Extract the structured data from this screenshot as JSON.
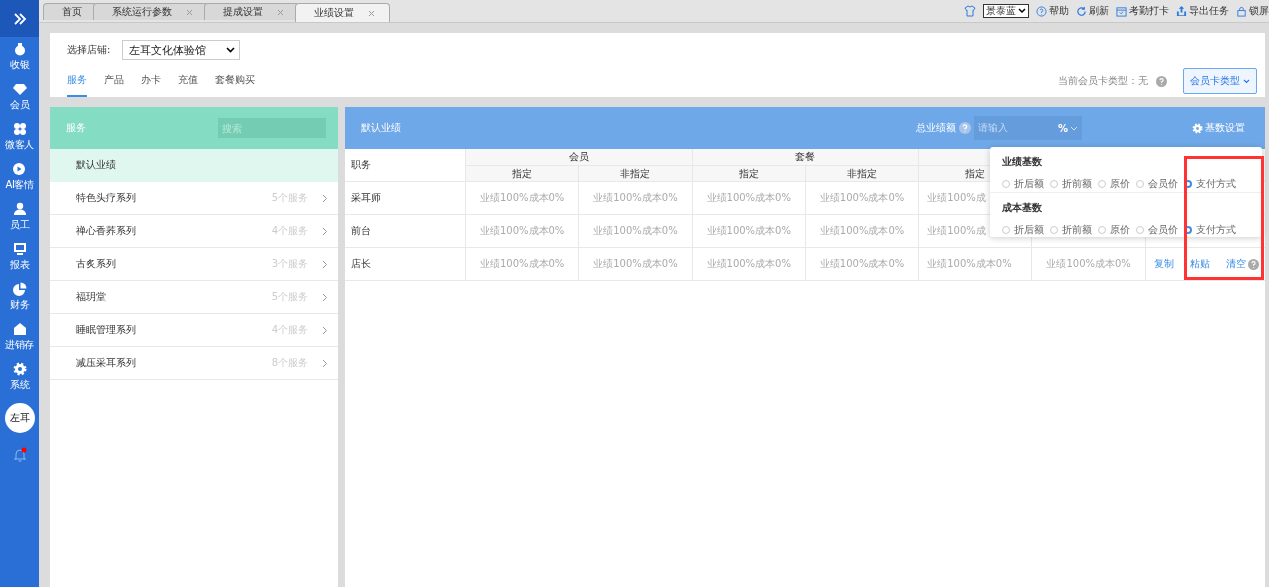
{
  "sidebar": {
    "items": [
      {
        "label": "收银",
        "kind": "cash"
      },
      {
        "label": "会员",
        "kind": "diamond"
      },
      {
        "label": "微客人",
        "kind": "clover"
      },
      {
        "label": "AI客情",
        "kind": "play"
      },
      {
        "label": "员工",
        "kind": "person"
      },
      {
        "label": "报表",
        "kind": "monitor"
      },
      {
        "label": "财务",
        "kind": "pie"
      },
      {
        "label": "进销存",
        "kind": "house"
      },
      {
        "label": "系统",
        "kind": "gear"
      }
    ],
    "avatar": "左耳"
  },
  "tabs": [
    {
      "label": "首页",
      "closable": false,
      "selected": false
    },
    {
      "label": "系统运行参数",
      "closable": true,
      "selected": false
    },
    {
      "label": "提成设置",
      "closable": true,
      "selected": false
    },
    {
      "label": "业绩设置",
      "closable": true,
      "selected": true
    }
  ],
  "toolbar": {
    "theme": "景泰蓝",
    "actions": [
      {
        "label": "帮助",
        "kind": "help"
      },
      {
        "label": "刷新",
        "kind": "refresh"
      },
      {
        "label": "考勤打卡",
        "kind": "calendar"
      },
      {
        "label": "导出任务",
        "kind": "export"
      },
      {
        "label": "锁屏",
        "kind": "lock"
      }
    ]
  },
  "store": {
    "label": "选择店铺:",
    "value": "左耳文化体验馆"
  },
  "category_tabs": [
    {
      "label": "服务",
      "selected": true
    },
    {
      "label": "产品",
      "selected": false
    },
    {
      "label": "办卡",
      "selected": false
    },
    {
      "label": "充值",
      "selected": false
    },
    {
      "label": "套餐购买",
      "selected": false
    }
  ],
  "card_type": {
    "current": "当前会员卡类型：无",
    "button": "会员卡类型"
  },
  "service_panel": {
    "title": "服务",
    "search_placeholder": "搜索",
    "items": [
      {
        "name": "默认业绩",
        "selected": true
      },
      {
        "name": "特色头疗系列",
        "count": "5个服务",
        "selected": false
      },
      {
        "name": "禅心香荞系列",
        "count": "4个服务",
        "selected": false
      },
      {
        "name": "古炙系列",
        "count": "3个服务",
        "selected": false
      },
      {
        "name": "福玥堂",
        "count": "5个服务",
        "selected": false
      },
      {
        "name": "睡眠管理系列",
        "count": "4个服务",
        "selected": false
      },
      {
        "name": "减压采耳系列",
        "count": "8个服务",
        "selected": false
      }
    ]
  },
  "performance": {
    "title": "默认业绩",
    "total_label": "总业绩额",
    "input_placeholder": "请输入",
    "unit": "%",
    "settings": "基数设置"
  },
  "table": {
    "row_header": "职务",
    "groups": [
      {
        "name": "会员",
        "columns": [
          "指定",
          "非指定"
        ]
      },
      {
        "name": "套餐",
        "columns": [
          "指定",
          "非指定"
        ]
      },
      {
        "columns": [
          "指定"
        ]
      }
    ],
    "rows": [
      {
        "role": "采耳师",
        "cells": [
          "业绩100%成本0%",
          "业绩100%成本0%",
          "业绩100%成本0%",
          "业绩100%成本0%",
          "业绩100%成"
        ]
      },
      {
        "role": "前台",
        "cells": [
          "业绩100%成本0%",
          "业绩100%成本0%",
          "业绩100%成本0%",
          "业绩100%成本0%",
          "业绩100%成"
        ]
      },
      {
        "role": "店长",
        "cells": [
          "业绩100%成本0%",
          "业绩100%成本0%",
          "业绩100%成本0%",
          "业绩100%成本0%",
          "业绩100%成本0%",
          "业绩100%成本0%"
        ],
        "actions": [
          "复制",
          "粘贴",
          "清空"
        ]
      }
    ]
  },
  "base_popover": {
    "sections": [
      {
        "title": "业绩基数",
        "options": [
          {
            "label": "折后额",
            "selected": false
          },
          {
            "label": "折前额",
            "selected": false
          },
          {
            "label": "原价",
            "selected": false
          },
          {
            "label": "会员价",
            "selected": false
          },
          {
            "label": "支付方式",
            "selected": true
          }
        ]
      },
      {
        "title": "成本基数",
        "options": [
          {
            "label": "折后额",
            "selected": false
          },
          {
            "label": "折前额",
            "selected": false
          },
          {
            "label": "原价",
            "selected": false
          },
          {
            "label": "会员价",
            "selected": false
          },
          {
            "label": "支付方式",
            "selected": true
          }
        ]
      }
    ]
  }
}
